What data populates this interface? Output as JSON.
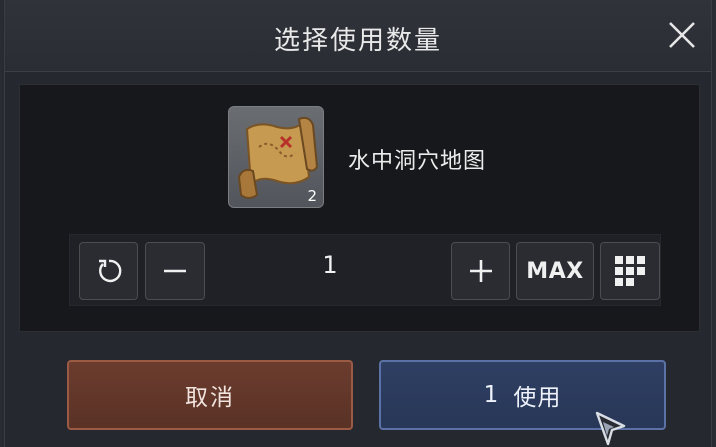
{
  "dialog": {
    "title": "选择使用数量",
    "close_icon": "close-icon"
  },
  "item": {
    "name": "水中洞穴地图",
    "owned_count": "2",
    "icon": "treasure-map-icon"
  },
  "stepper": {
    "quantity": "1",
    "reset_icon": "reset-icon",
    "minus_icon": "minus-icon",
    "plus_icon": "plus-icon",
    "max_label": "MAX",
    "keypad_icon": "keypad-icon"
  },
  "actions": {
    "cancel_label": "取消",
    "use_count": "1",
    "use_label": "使用"
  },
  "colors": {
    "cancel_bg": "#6b3c2e",
    "use_bg": "#2f3f63"
  }
}
